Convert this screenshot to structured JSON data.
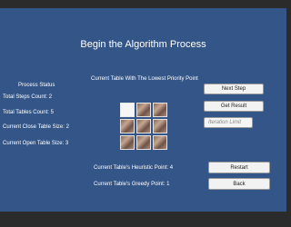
{
  "title": "Begin the Algorithm Process",
  "lowest_priority_label": "Current Table With The Lowest Priority Point",
  "process_status": {
    "title": "Process Status",
    "total_steps": "Total Steps Count: 2",
    "total_tables": "Total Tables Count: 5",
    "close_table_size": "Current Close Table Size: 2",
    "open_table_size": "Current Open Table Size: 3"
  },
  "buttons": {
    "next_step": "Next Step",
    "get_result": "Get Result",
    "restart": "Restart",
    "back": "Back"
  },
  "iteration_limit": {
    "placeholder": "Iteration Limit",
    "value": ""
  },
  "heuristic_point": "Current Table's Heuristic Point: 4",
  "greedy_point": "Current Table's Greedy Point: 1",
  "puzzle": {
    "rows": 3,
    "cols": 3,
    "blank_position": "top-left"
  }
}
